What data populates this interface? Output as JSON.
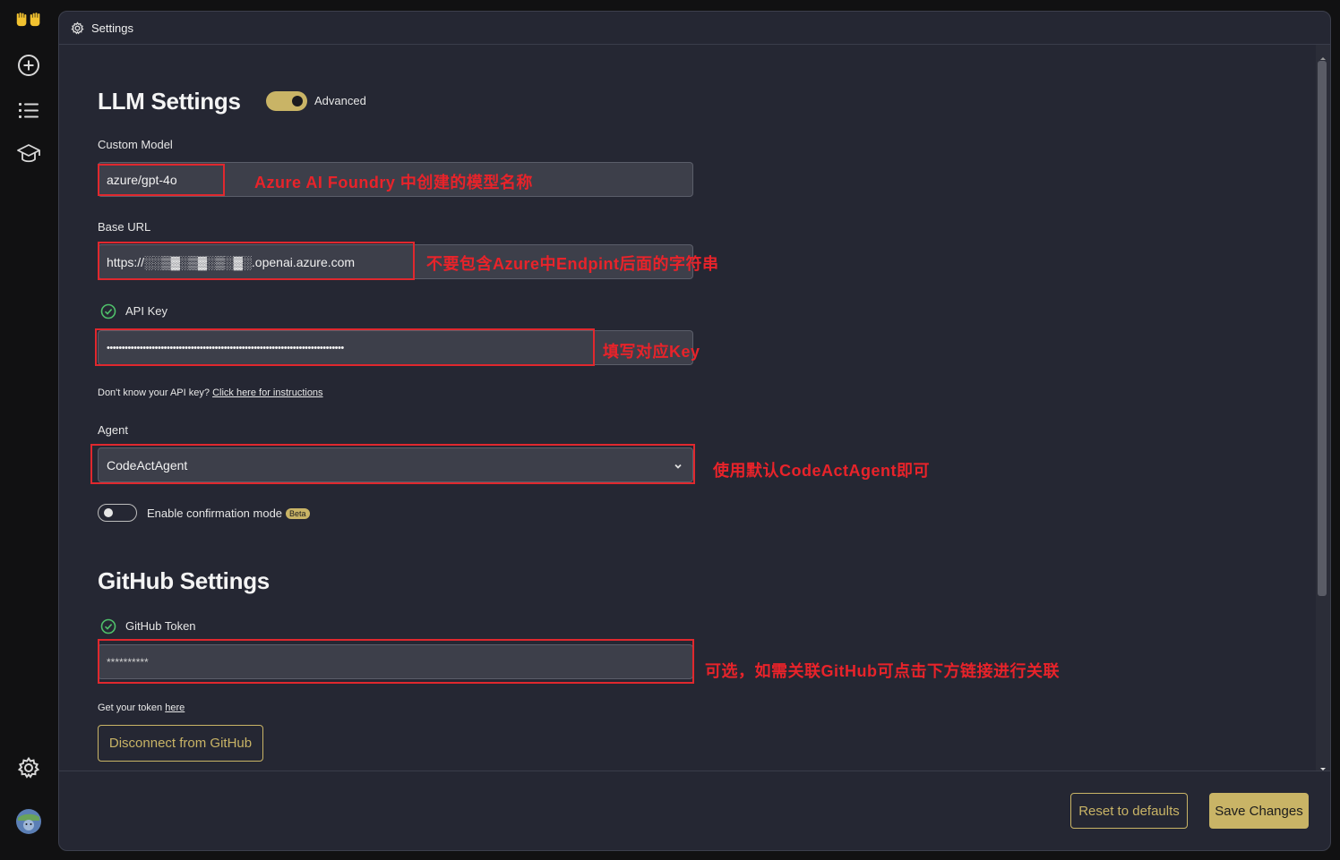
{
  "window": {
    "title": "Settings"
  },
  "llm": {
    "heading": "LLM Settings",
    "advanced_label": "Advanced",
    "custom_model": {
      "label": "Custom Model",
      "value": "azure/gpt-4o",
      "annotation": "Azure AI Foundry 中创建的模型名称"
    },
    "base_url": {
      "label": "Base URL",
      "value": "https://░░▒▓░▒▓░▒░▓░.openai.azure.com",
      "annotation": "不要包含Azure中Endpint后面的字符串"
    },
    "api_key": {
      "label": "API Key",
      "value": "•••••••••••••••••••••••••••••••••••••••••••••••••••••••••••••••••••••••••••••••",
      "annotation": "填写对应Key"
    },
    "help_text": "Don't know your API key?",
    "help_link": "Click here for instructions",
    "agent": {
      "label": "Agent",
      "value": "CodeActAgent",
      "annotation": "使用默认CodeActAgent即可"
    },
    "confirmation": {
      "label": "Enable confirmation mode",
      "badge": "Beta",
      "enabled": false
    }
  },
  "github": {
    "heading": "GitHub Settings",
    "token_label": "GitHub Token",
    "token_value": "**********",
    "annotation": "可选，如需关联GitHub可点击下方链接进行关联",
    "help_text": "Get your token",
    "help_link": "here",
    "disconnect_label": "Disconnect from GitHub"
  },
  "footer": {
    "reset_label": "Reset to defaults",
    "save_label": "Save Changes"
  },
  "colors": {
    "accent": "#c9b466",
    "annotation_red": "#e0282e",
    "background": "#252733"
  },
  "icons": [
    "hands-logo-icon",
    "plus-circle-icon",
    "list-icon",
    "graduation-cap-icon",
    "settings-gear-icon",
    "user-avatar"
  ]
}
